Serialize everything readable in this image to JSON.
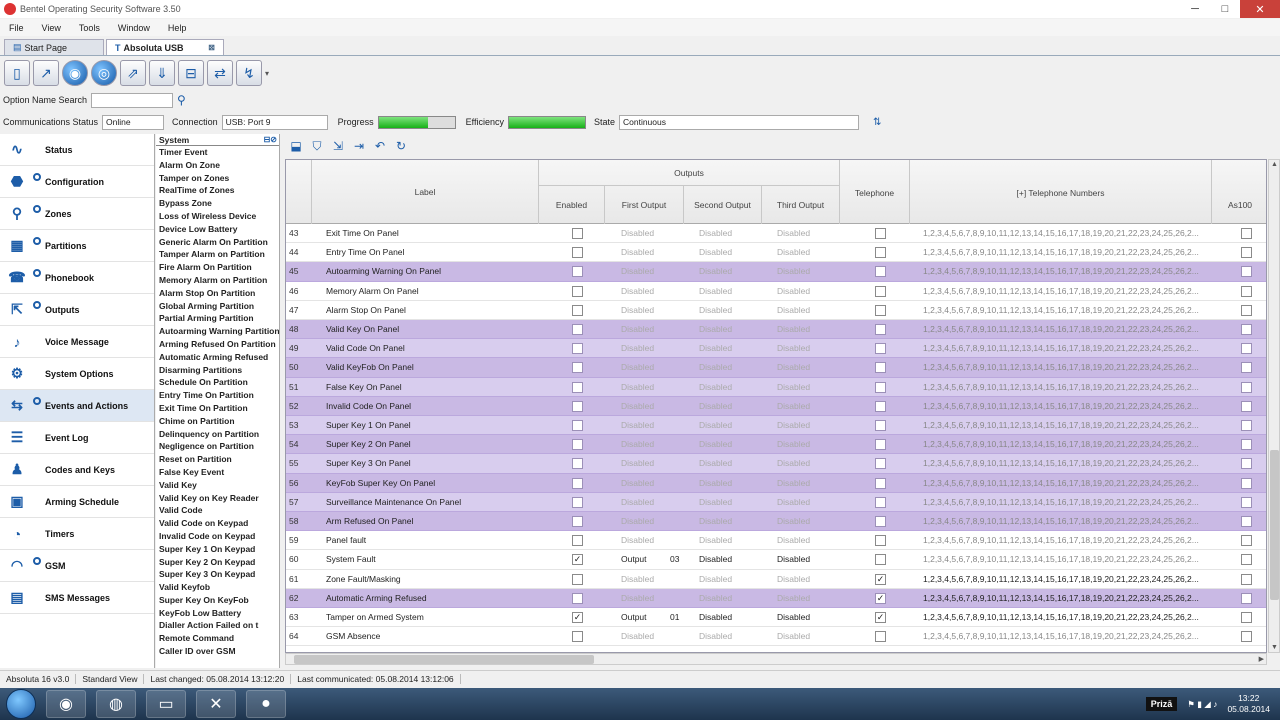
{
  "window": {
    "title": "Bentel Operating Security Software 3.50",
    "minimize": "─",
    "maximize": "□",
    "close": "✕"
  },
  "menu": [
    "File",
    "View",
    "Tools",
    "Window",
    "Help"
  ],
  "tabs": [
    {
      "label": "Start Page"
    },
    {
      "label": "Absoluta USB"
    }
  ],
  "search": {
    "label": "Option Name Search",
    "value": ""
  },
  "status": {
    "comm_label": "Communications Status",
    "comm_value": "Online",
    "conn_label": "Connection",
    "conn_value": "USB: Port 9",
    "progress_label": "Progress",
    "progress": 0.65,
    "efficiency_label": "Efficiency",
    "efficiency": 1.0,
    "state_label": "State",
    "state_value": "Continuous"
  },
  "sidebar": [
    {
      "label": "Status",
      "icon": "pulse-icon",
      "sym": "∿",
      "ring": false
    },
    {
      "label": "Configuration",
      "icon": "configuration-icon",
      "sym": "⬣",
      "ring": true
    },
    {
      "label": "Zones",
      "icon": "zones-icon",
      "sym": "⚲",
      "ring": true
    },
    {
      "label": "Partitions",
      "icon": "partitions-icon",
      "sym": "▦",
      "ring": true
    },
    {
      "label": "Phonebook",
      "icon": "phonebook-icon",
      "sym": "☎",
      "ring": true
    },
    {
      "label": "Outputs",
      "icon": "outputs-icon",
      "sym": "⇱",
      "ring": true
    },
    {
      "label": "Voice Message",
      "icon": "microphone-icon",
      "sym": "♪",
      "ring": false
    },
    {
      "label": "System Options",
      "icon": "gear-icon",
      "sym": "⚙",
      "ring": false
    },
    {
      "label": "Events and Actions",
      "icon": "events-icon",
      "sym": "⇆",
      "ring": true,
      "active": true
    },
    {
      "label": "Event Log",
      "icon": "event-log-icon",
      "sym": "☰",
      "ring": false
    },
    {
      "label": "Codes and Keys",
      "icon": "codes-icon",
      "sym": "♟",
      "ring": false
    },
    {
      "label": "Arming Schedule",
      "icon": "calendar-icon",
      "sym": "▣",
      "ring": false
    },
    {
      "label": "Timers",
      "icon": "clock-icon",
      "sym": "◔",
      "ring": false
    },
    {
      "label": "GSM",
      "icon": "wifi-icon",
      "sym": "◠",
      "ring": true
    },
    {
      "label": "SMS Messages",
      "icon": "sms-icon",
      "sym": "▤",
      "ring": false
    }
  ],
  "events": {
    "header": "System",
    "items": [
      "Timer Event",
      "Alarm On Zone",
      "Tamper on Zones",
      "RealTime of Zones",
      "Bypass Zone",
      "Loss of Wireless Device",
      "Device Low Battery",
      "Generic Alarm On Partition",
      "Tamper Alarm on Partition",
      "Fire Alarm On Partition",
      "Memory Alarm on Partition",
      "Alarm Stop On Partition",
      "Global Arming Partition",
      "Partial Arming Partition",
      "Autoarming Warning Partition",
      "Arming Refused On Partition",
      "Automatic Arming Refused",
      "Disarming Partitions",
      "Schedule On Partition",
      "Entry Time On Partition",
      "Exit Time On Partition",
      "Chime on Partition",
      "Delinquency on Partition",
      "Negligence on Partition",
      "Reset on Partition",
      "False Key Event",
      "Valid Key",
      "Valid Key on Key Reader",
      "Valid Code",
      "Valid Code on Keypad",
      "Invalid Code on Keypad",
      "Super Key 1 On Keypad",
      "Super Key 2 On Keypad",
      "Super Key 3 On Keypad",
      "Valid Keyfob",
      "Super Key On KeyFob",
      "KeyFob Low Battery",
      "Dialler Action Failed on t",
      "Remote Command",
      "Caller ID over GSM"
    ]
  },
  "grid": {
    "headers": {
      "label": "Label",
      "outputs": "Outputs",
      "enabled": "Enabled",
      "first": "First Output",
      "second": "Second Output",
      "third": "Third Output",
      "telephone": "Telephone",
      "numbers": "[+] Telephone Numbers",
      "as100": "As100"
    },
    "rows": [
      {
        "n": "43",
        "label": "Exit Time On Panel",
        "en": false,
        "o1": "Disabled",
        "o2": "Disabled",
        "o3": "Disabled",
        "tel": false,
        "nums": "1,2,3,4,5,6,7,8,9,10,11,12,13,14,15,16,17,18,19,20,21,22,23,24,25,26,2...",
        "hl": false
      },
      {
        "n": "44",
        "label": "Entry Time On Panel",
        "en": false,
        "o1": "Disabled",
        "o2": "Disabled",
        "o3": "Disabled",
        "tel": false,
        "nums": "1,2,3,4,5,6,7,8,9,10,11,12,13,14,15,16,17,18,19,20,21,22,23,24,25,26,2...",
        "hl": false
      },
      {
        "n": "45",
        "label": "Autoarming Warning On Panel",
        "en": false,
        "o1": "Disabled",
        "o2": "Disabled",
        "o3": "Disabled",
        "tel": false,
        "nums": "1,2,3,4,5,6,7,8,9,10,11,12,13,14,15,16,17,18,19,20,21,22,23,24,25,26,2...",
        "hl": true
      },
      {
        "n": "46",
        "label": "Memory Alarm On Panel",
        "en": false,
        "o1": "Disabled",
        "o2": "Disabled",
        "o3": "Disabled",
        "tel": false,
        "nums": "1,2,3,4,5,6,7,8,9,10,11,12,13,14,15,16,17,18,19,20,21,22,23,24,25,26,2...",
        "hl": false
      },
      {
        "n": "47",
        "label": "Alarm Stop On Panel",
        "en": false,
        "o1": "Disabled",
        "o2": "Disabled",
        "o3": "Disabled",
        "tel": false,
        "nums": "1,2,3,4,5,6,7,8,9,10,11,12,13,14,15,16,17,18,19,20,21,22,23,24,25,26,2...",
        "hl": false
      },
      {
        "n": "48",
        "label": "Valid Key On Panel",
        "en": false,
        "o1": "Disabled",
        "o2": "Disabled",
        "o3": "Disabled",
        "tel": false,
        "nums": "1,2,3,4,5,6,7,8,9,10,11,12,13,14,15,16,17,18,19,20,21,22,23,24,25,26,2...",
        "hl": true
      },
      {
        "n": "49",
        "label": "Valid Code On Panel",
        "en": false,
        "o1": "Disabled",
        "o2": "Disabled",
        "o3": "Disabled",
        "tel": false,
        "nums": "1,2,3,4,5,6,7,8,9,10,11,12,13,14,15,16,17,18,19,20,21,22,23,24,25,26,2...",
        "hl": true,
        "alt": true
      },
      {
        "n": "50",
        "label": "Valid KeyFob On Panel",
        "en": false,
        "o1": "Disabled",
        "o2": "Disabled",
        "o3": "Disabled",
        "tel": false,
        "nums": "1,2,3,4,5,6,7,8,9,10,11,12,13,14,15,16,17,18,19,20,21,22,23,24,25,26,2...",
        "hl": true
      },
      {
        "n": "51",
        "label": "False Key On Panel",
        "en": false,
        "o1": "Disabled",
        "o2": "Disabled",
        "o3": "Disabled",
        "tel": false,
        "nums": "1,2,3,4,5,6,7,8,9,10,11,12,13,14,15,16,17,18,19,20,21,22,23,24,25,26,2...",
        "hl": true,
        "alt": true
      },
      {
        "n": "52",
        "label": "Invalid Code On Panel",
        "en": false,
        "o1": "Disabled",
        "o2": "Disabled",
        "o3": "Disabled",
        "tel": false,
        "nums": "1,2,3,4,5,6,7,8,9,10,11,12,13,14,15,16,17,18,19,20,21,22,23,24,25,26,2...",
        "hl": true
      },
      {
        "n": "53",
        "label": "Super Key 1 On Panel",
        "en": false,
        "o1": "Disabled",
        "o2": "Disabled",
        "o3": "Disabled",
        "tel": false,
        "nums": "1,2,3,4,5,6,7,8,9,10,11,12,13,14,15,16,17,18,19,20,21,22,23,24,25,26,2...",
        "hl": true,
        "alt": true
      },
      {
        "n": "54",
        "label": "Super Key 2 On Panel",
        "en": false,
        "o1": "Disabled",
        "o2": "Disabled",
        "o3": "Disabled",
        "tel": false,
        "nums": "1,2,3,4,5,6,7,8,9,10,11,12,13,14,15,16,17,18,19,20,21,22,23,24,25,26,2...",
        "hl": true
      },
      {
        "n": "55",
        "label": "Super Key 3 On Panel",
        "en": false,
        "o1": "Disabled",
        "o2": "Disabled",
        "o3": "Disabled",
        "tel": false,
        "nums": "1,2,3,4,5,6,7,8,9,10,11,12,13,14,15,16,17,18,19,20,21,22,23,24,25,26,2...",
        "hl": true,
        "alt": true
      },
      {
        "n": "56",
        "label": "KeyFob Super Key On Panel",
        "en": false,
        "o1": "Disabled",
        "o2": "Disabled",
        "o3": "Disabled",
        "tel": false,
        "nums": "1,2,3,4,5,6,7,8,9,10,11,12,13,14,15,16,17,18,19,20,21,22,23,24,25,26,2...",
        "hl": true
      },
      {
        "n": "57",
        "label": "Surveillance Maintenance On Panel",
        "en": false,
        "o1": "Disabled",
        "o2": "Disabled",
        "o3": "Disabled",
        "tel": false,
        "nums": "1,2,3,4,5,6,7,8,9,10,11,12,13,14,15,16,17,18,19,20,21,22,23,24,25,26,2...",
        "hl": true,
        "alt": true
      },
      {
        "n": "58",
        "label": "Arm Refused On Panel",
        "en": false,
        "o1": "Disabled",
        "o2": "Disabled",
        "o3": "Disabled",
        "tel": false,
        "nums": "1,2,3,4,5,6,7,8,9,10,11,12,13,14,15,16,17,18,19,20,21,22,23,24,25,26,2...",
        "hl": true
      },
      {
        "n": "59",
        "label": "Panel fault",
        "en": false,
        "o1": "Disabled",
        "o2": "Disabled",
        "o3": "Disabled",
        "tel": false,
        "nums": "1,2,3,4,5,6,7,8,9,10,11,12,13,14,15,16,17,18,19,20,21,22,23,24,25,26,2...",
        "hl": false
      },
      {
        "n": "60",
        "label": "System Fault",
        "en": true,
        "o1": "Output",
        "o1n": "03",
        "o2": "Disabled",
        "o3": "Disabled",
        "tel": false,
        "nums": "1,2,3,4,5,6,7,8,9,10,11,12,13,14,15,16,17,18,19,20,21,22,23,24,25,26,2...",
        "hl": false,
        "active": true
      },
      {
        "n": "61",
        "label": "Zone Fault/Masking",
        "en": false,
        "o1": "Disabled",
        "o2": "Disabled",
        "o3": "Disabled",
        "tel": true,
        "nums": "1,2,3,4,5,6,7,8,9,10,11,12,13,14,15,16,17,18,19,20,21,22,23,24,25,26,2...",
        "hl": false,
        "numsOn": true
      },
      {
        "n": "62",
        "label": "Automatic Arming Refused",
        "en": false,
        "o1": "Disabled",
        "o2": "Disabled",
        "o3": "Disabled",
        "tel": true,
        "nums": "1,2,3,4,5,6,7,8,9,10,11,12,13,14,15,16,17,18,19,20,21,22,23,24,25,26,2...",
        "hl": true,
        "numsOn": true
      },
      {
        "n": "63",
        "label": "Tamper on Armed System",
        "en": true,
        "o1": "Output",
        "o1n": "01",
        "o2": "Disabled",
        "o3": "Disabled",
        "tel": true,
        "nums": "1,2,3,4,5,6,7,8,9,10,11,12,13,14,15,16,17,18,19,20,21,22,23,24,25,26,2...",
        "hl": false,
        "active": true,
        "numsOn": true
      },
      {
        "n": "64",
        "label": "GSM Absence",
        "en": false,
        "o1": "Disabled",
        "o2": "Disabled",
        "o3": "Disabled",
        "tel": false,
        "nums": "1,2,3,4,5,6,7,8,9,10,11,12,13,14,15,16,17,18,19,20,21,22,23,24,25,26,2...",
        "hl": false
      }
    ]
  },
  "statusbar": [
    "Absoluta 16 v3.0",
    "Standard View",
    "Last changed: 05.08.2014 13:12:20",
    "Last communicated: 05.08.2014 13:12:06"
  ],
  "taskbar": {
    "lang": "Prizā",
    "time": "13:22",
    "date": "05.08.2014"
  }
}
